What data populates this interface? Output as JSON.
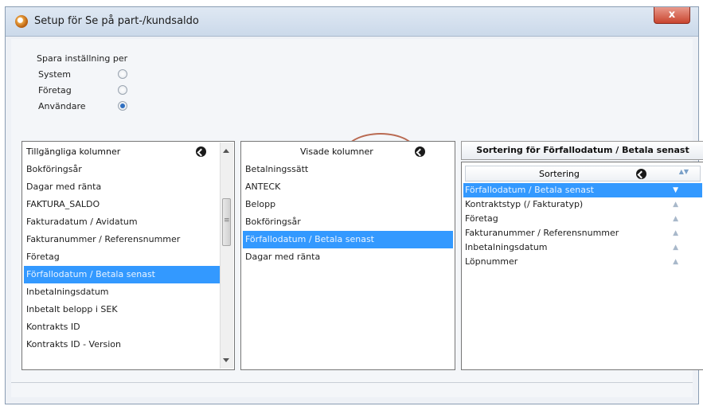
{
  "window": {
    "title": "Setup för Se på part-/kundsaldo",
    "close_label": "x"
  },
  "save_group": {
    "label": "Spara inställning per",
    "options": [
      {
        "label": "System",
        "selected": false
      },
      {
        "label": "Företag",
        "selected": false
      },
      {
        "label": "Användare",
        "selected": true
      }
    ]
  },
  "available": {
    "header": "Tillgängliga kolumner",
    "items": [
      "Bokföringsår",
      "Dagar med ränta",
      "FAKTURA_SALDO",
      "Fakturadatum / Avidatum",
      "Fakturanummer / Referensnummer",
      "Företag",
      "Förfallodatum / Betala senast",
      "Inbetalningsdatum",
      "Inbetalt belopp i SEK",
      "Kontrakts ID",
      "Kontrakts ID - Version"
    ],
    "selected_index": 6
  },
  "shown": {
    "header": "Visade kolumner",
    "items": [
      "Betalningssätt",
      "ANTECK",
      "Belopp",
      "Bokföringsår",
      "Förfallodatum / Betala senast",
      "Dagar med ränta"
    ],
    "selected_index": 4
  },
  "sorting": {
    "title": "Sortering för Förfallodatum / Betala senast",
    "header": "Sortering",
    "header_arrows": "▲▼",
    "items": [
      {
        "label": "Förfallodatum / Betala senast",
        "arrow": "▼"
      },
      {
        "label": "Kontraktstyp (/ Fakturatyp)",
        "arrow": "▲"
      },
      {
        "label": "Företag",
        "arrow": "▲"
      },
      {
        "label": "Fakturanummer / Referensnummer",
        "arrow": "▲"
      },
      {
        "label": "Inbetalningsdatum",
        "arrow": "▲"
      },
      {
        "label": "Löpnummer",
        "arrow": "▲"
      }
    ],
    "selected_index": 0
  }
}
